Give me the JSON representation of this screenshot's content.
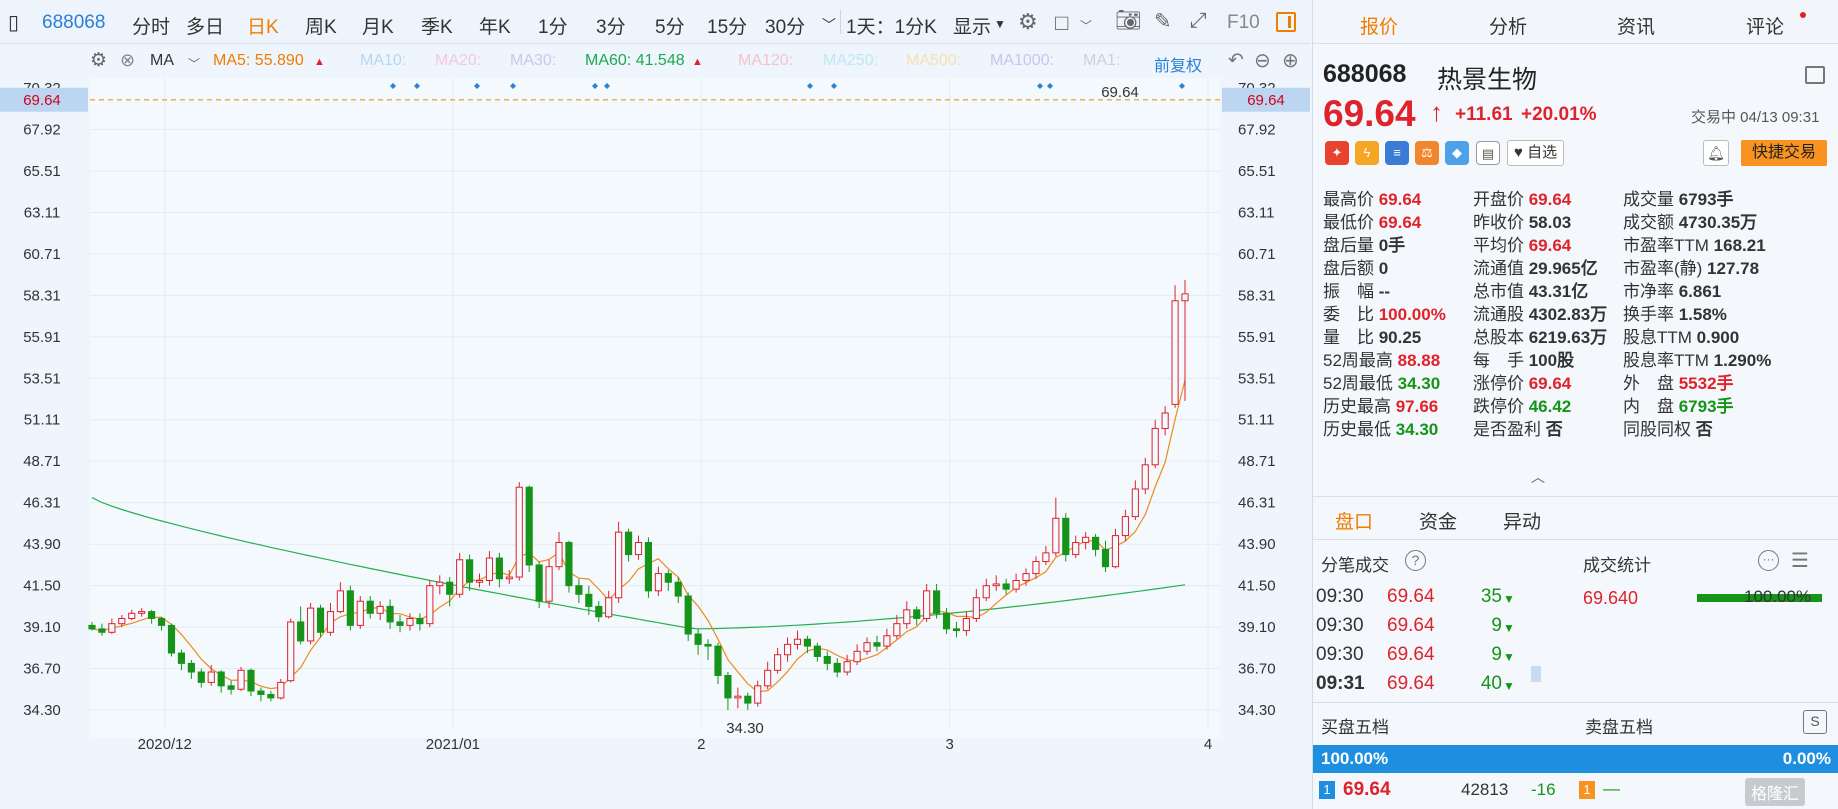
{
  "toolbar": {
    "code": "688068",
    "tabs": [
      "分时",
      "多日",
      "日K",
      "周K",
      "月K",
      "季K",
      "年K",
      "1分",
      "3分",
      "5分",
      "15分",
      "30分"
    ],
    "active_tab": "日K",
    "period": "1天：1分K",
    "display": "显示",
    "f10": "F10"
  },
  "ma": {
    "label": "MA",
    "ma5": "MA5: 55.890",
    "ma10": "MA10:",
    "ma20": "MA20:",
    "ma30": "MA30:",
    "ma60": "MA60: 41.548",
    "ma120": "MA120:",
    "ma250": "MA250:",
    "ma500": "MA500:",
    "ma1000": "MA1000:",
    "ma1x": "MA1:",
    "adjust": "前复权"
  },
  "chart_data": {
    "type": "candlestick",
    "y_ticks": [
      "70.32",
      "69.64",
      "67.92",
      "65.51",
      "63.11",
      "60.71",
      "58.31",
      "55.91",
      "53.51",
      "51.11",
      "48.71",
      "46.31",
      "43.90",
      "41.50",
      "39.10",
      "36.70",
      "34.30"
    ],
    "x_ticks": [
      "2020/12",
      "2021/01",
      "2",
      "3",
      "4"
    ],
    "ylim": [
      33.2,
      70.9
    ],
    "current_price": "69.64",
    "high_annotation": "69.64",
    "low_annotation": "34.30",
    "candles": [
      [
        39.2,
        39.0,
        39.4,
        38.9
      ],
      [
        39.0,
        38.8,
        39.3,
        38.6
      ],
      [
        38.8,
        39.3,
        39.6,
        38.7
      ],
      [
        39.3,
        39.6,
        39.8,
        39.1
      ],
      [
        39.6,
        39.9,
        40.1,
        39.5
      ],
      [
        39.9,
        40.0,
        40.2,
        39.7
      ],
      [
        40.0,
        39.6,
        40.1,
        39.3
      ],
      [
        39.6,
        39.2,
        39.7,
        38.9
      ],
      [
        39.2,
        37.6,
        39.3,
        37.4
      ],
      [
        37.6,
        37.0,
        37.8,
        36.6
      ],
      [
        37.0,
        36.5,
        37.2,
        36.1
      ],
      [
        36.5,
        35.9,
        36.7,
        35.6
      ],
      [
        35.9,
        36.5,
        36.9,
        35.7
      ],
      [
        36.5,
        35.7,
        36.6,
        35.3
      ],
      [
        35.7,
        35.5,
        36.0,
        35.2
      ],
      [
        35.5,
        36.6,
        36.8,
        35.4
      ],
      [
        36.6,
        35.4,
        36.7,
        35.1
      ],
      [
        35.4,
        35.2,
        35.6,
        34.8
      ],
      [
        35.2,
        35.0,
        35.4,
        34.8
      ],
      [
        35.0,
        35.9,
        36.1,
        34.9
      ],
      [
        36.0,
        39.4,
        39.6,
        35.9
      ],
      [
        39.4,
        38.3,
        40.3,
        38.1
      ],
      [
        38.3,
        40.2,
        40.5,
        38.1
      ],
      [
        40.2,
        38.8,
        40.4,
        38.5
      ],
      [
        38.8,
        40.0,
        40.5,
        38.6
      ],
      [
        40.0,
        41.2,
        41.7,
        39.9
      ],
      [
        41.2,
        39.2,
        41.5,
        38.9
      ],
      [
        39.2,
        40.6,
        40.9,
        39.0
      ],
      [
        40.6,
        39.9,
        40.9,
        39.6
      ],
      [
        39.9,
        40.3,
        40.6,
        39.5
      ],
      [
        40.3,
        39.4,
        40.7,
        39.0
      ],
      [
        39.4,
        39.2,
        39.8,
        38.8
      ],
      [
        39.2,
        39.6,
        39.9,
        38.9
      ],
      [
        39.6,
        39.3,
        39.9,
        38.9
      ],
      [
        39.3,
        41.5,
        41.8,
        39.1
      ],
      [
        41.5,
        41.7,
        42.1,
        41.0
      ],
      [
        41.7,
        41.0,
        42.0,
        40.3
      ],
      [
        41.0,
        43.0,
        43.4,
        40.8
      ],
      [
        43.0,
        41.7,
        43.3,
        41.2
      ],
      [
        41.7,
        41.8,
        42.2,
        41.4
      ],
      [
        41.8,
        43.1,
        43.5,
        41.5
      ],
      [
        43.1,
        41.9,
        43.4,
        41.4
      ],
      [
        41.9,
        42.0,
        42.4,
        41.6
      ],
      [
        42.0,
        47.2,
        47.5,
        41.8
      ],
      [
        47.2,
        42.7,
        47.3,
        42.3
      ],
      [
        42.7,
        40.6,
        42.9,
        40.2
      ],
      [
        40.6,
        42.6,
        43.0,
        40.2
      ],
      [
        42.6,
        44.0,
        44.6,
        42.4
      ],
      [
        44.0,
        41.5,
        44.1,
        41.1
      ],
      [
        41.5,
        41.0,
        41.9,
        40.5
      ],
      [
        41.0,
        40.3,
        41.5,
        39.8
      ],
      [
        40.3,
        39.7,
        40.6,
        39.4
      ],
      [
        39.7,
        40.8,
        41.2,
        39.6
      ],
      [
        40.8,
        44.6,
        45.2,
        40.5
      ],
      [
        44.6,
        43.3,
        44.8,
        42.9
      ],
      [
        43.3,
        44.0,
        44.4,
        43.0
      ],
      [
        44.0,
        41.2,
        44.3,
        40.8
      ],
      [
        41.2,
        42.2,
        42.6,
        40.9
      ],
      [
        42.2,
        41.7,
        42.4,
        41.2
      ],
      [
        41.7,
        40.9,
        42.0,
        40.5
      ],
      [
        40.9,
        38.7,
        41.1,
        38.3
      ],
      [
        38.7,
        38.1,
        39.0,
        37.5
      ],
      [
        38.1,
        38.0,
        38.4,
        37.2
      ],
      [
        38.0,
        36.3,
        38.2,
        35.8
      ],
      [
        36.3,
        35.0,
        36.5,
        34.3
      ],
      [
        35.0,
        35.1,
        35.6,
        34.4
      ],
      [
        35.1,
        34.7,
        35.3,
        34.3
      ],
      [
        34.7,
        35.7,
        36.0,
        34.5
      ],
      [
        35.7,
        36.6,
        37.1,
        35.5
      ],
      [
        36.6,
        37.5,
        37.9,
        36.4
      ],
      [
        37.5,
        38.1,
        38.5,
        37.1
      ],
      [
        38.1,
        38.4,
        38.9,
        37.8
      ],
      [
        38.4,
        38.0,
        38.6,
        37.6
      ],
      [
        38.0,
        37.4,
        38.2,
        37.1
      ],
      [
        37.4,
        37.0,
        37.7,
        36.6
      ],
      [
        37.0,
        36.5,
        37.3,
        36.2
      ],
      [
        36.5,
        37.1,
        37.5,
        36.3
      ],
      [
        37.1,
        37.7,
        38.1,
        36.9
      ],
      [
        37.7,
        38.2,
        38.5,
        37.5
      ],
      [
        38.2,
        38.0,
        38.6,
        37.7
      ],
      [
        38.0,
        38.6,
        39.0,
        37.8
      ],
      [
        38.6,
        39.3,
        39.8,
        38.4
      ],
      [
        39.3,
        40.1,
        40.6,
        39.0
      ],
      [
        40.1,
        39.6,
        40.3,
        39.2
      ],
      [
        39.6,
        41.2,
        41.6,
        39.4
      ],
      [
        41.2,
        39.9,
        41.6,
        39.6
      ],
      [
        39.9,
        39.0,
        40.2,
        38.7
      ],
      [
        39.0,
        38.9,
        39.4,
        38.5
      ],
      [
        38.9,
        39.6,
        40.0,
        38.6
      ],
      [
        39.6,
        40.8,
        41.3,
        39.4
      ],
      [
        40.8,
        41.5,
        41.9,
        40.6
      ],
      [
        41.5,
        41.6,
        42.1,
        41.2
      ],
      [
        41.6,
        41.3,
        41.9,
        41.0
      ],
      [
        41.3,
        41.8,
        42.2,
        41.1
      ],
      [
        41.8,
        42.2,
        42.5,
        41.5
      ],
      [
        42.2,
        42.9,
        43.2,
        41.9
      ],
      [
        42.9,
        43.4,
        43.8,
        42.7
      ],
      [
        43.4,
        45.4,
        46.6,
        43.2
      ],
      [
        45.4,
        43.3,
        45.7,
        42.9
      ],
      [
        43.3,
        44.0,
        44.4,
        43.1
      ],
      [
        44.0,
        44.3,
        44.6,
        43.6
      ],
      [
        44.3,
        43.6,
        44.5,
        43.2
      ],
      [
        43.6,
        42.6,
        44.1,
        42.3
      ],
      [
        42.6,
        44.4,
        44.8,
        42.5
      ],
      [
        44.4,
        45.5,
        45.9,
        44.1
      ],
      [
        45.5,
        47.1,
        47.6,
        45.3
      ],
      [
        47.1,
        48.5,
        48.9,
        46.8
      ],
      [
        48.5,
        50.6,
        51.1,
        48.3
      ],
      [
        50.6,
        51.5,
        51.9,
        50.2
      ],
      [
        52.0,
        58.0,
        58.9,
        51.8
      ],
      [
        58.0,
        58.4,
        59.2,
        52.2
      ]
    ]
  },
  "quote": {
    "code": "688068",
    "name": "热景生物",
    "price": "69.64",
    "change": "+11.61",
    "pct": "+20.01%",
    "status": "交易中 04/13 09:31",
    "watchlist": "自选",
    "quick_trade": "快捷交易",
    "fields": [
      {
        "label": "最高价",
        "value": "69.64",
        "color": "red"
      },
      {
        "label": "开盘价",
        "value": "69.64",
        "color": "red"
      },
      {
        "label": "成交量",
        "value": "6793手",
        "color": "black"
      },
      {
        "label": "最低价",
        "value": "69.64",
        "color": "red"
      },
      {
        "label": "昨收价",
        "value": "58.03",
        "color": "black"
      },
      {
        "label": "成交额",
        "value": "4730.35万",
        "color": "black"
      },
      {
        "label": "盘后量",
        "value": "0手",
        "color": "black"
      },
      {
        "label": "平均价",
        "value": "69.64",
        "color": "red"
      },
      {
        "label": "市盈率TTM",
        "value": "168.21",
        "color": "black"
      },
      {
        "label": "盘后额",
        "value": "0",
        "color": "black"
      },
      {
        "label": "流通值",
        "value": "29.965亿",
        "color": "black"
      },
      {
        "label": "市盈率(静)",
        "value": "127.78",
        "color": "black"
      },
      {
        "label": "振　幅",
        "value": "--",
        "color": "black"
      },
      {
        "label": "总市值",
        "value": "43.31亿",
        "color": "black"
      },
      {
        "label": "市净率",
        "value": "6.861",
        "color": "black"
      },
      {
        "label": "委　比",
        "value": "100.00%",
        "color": "red"
      },
      {
        "label": "流通股",
        "value": "4302.83万",
        "color": "black"
      },
      {
        "label": "换手率",
        "value": "1.58%",
        "color": "black"
      },
      {
        "label": "量　比",
        "value": "90.25",
        "color": "black"
      },
      {
        "label": "总股本",
        "value": "6219.63万",
        "color": "black"
      },
      {
        "label": "股息TTM",
        "value": "0.900",
        "color": "black"
      },
      {
        "label": "52周最高",
        "value": "88.88",
        "color": "red"
      },
      {
        "label": "每　手",
        "value": "100股",
        "color": "black"
      },
      {
        "label": "股息率TTM",
        "value": "1.290%",
        "color": "black"
      },
      {
        "label": "52周最低",
        "value": "34.30",
        "color": "green"
      },
      {
        "label": "涨停价",
        "value": "69.64",
        "color": "red"
      },
      {
        "label": "外　盘",
        "value": "5532手",
        "color": "red"
      },
      {
        "label": "历史最高",
        "value": "97.66",
        "color": "red"
      },
      {
        "label": "跌停价",
        "value": "46.42",
        "color": "green"
      },
      {
        "label": "内　盘",
        "value": "6793手",
        "color": "green"
      },
      {
        "label": "历史最低",
        "value": "34.30",
        "color": "green"
      },
      {
        "label": "是否盈利",
        "value": "否",
        "color": "black"
      },
      {
        "label": "同股同权",
        "value": "否",
        "color": "black"
      }
    ]
  },
  "right_tabs": [
    "报价",
    "分析",
    "资讯",
    "评论"
  ],
  "sub_tabs": [
    "盘口",
    "资金",
    "异动"
  ],
  "ticks": {
    "title": "分笔成交",
    "stats_title": "成交统计",
    "stats_price": "69.640",
    "stats_pct": "100.00%",
    "rows": [
      {
        "time": "09:30",
        "price": "69.64",
        "vol": "35"
      },
      {
        "time": "09:30",
        "price": "69.64",
        "vol": "9"
      },
      {
        "time": "09:30",
        "price": "69.64",
        "vol": "9"
      },
      {
        "time": "09:31",
        "price": "69.64",
        "vol": "40"
      }
    ]
  },
  "order_book": {
    "buy_title": "买盘五档",
    "sell_title": "卖盘五档",
    "buy_pct": "100.00%",
    "sell_pct": "0.00%",
    "buy1_idx": "1",
    "buy1_price": "69.64",
    "buy1_vol": "42813",
    "buy1_chg": "-16",
    "sell1_idx": "1",
    "sell1_price": "—"
  },
  "watermark": "格隆汇"
}
